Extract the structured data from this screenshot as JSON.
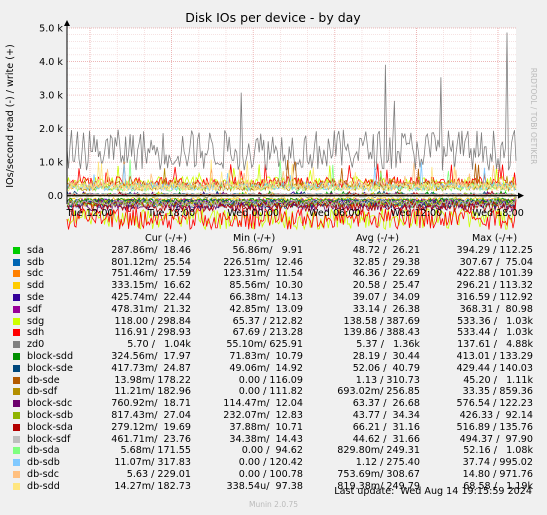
{
  "chart_data": {
    "type": "line",
    "title": "Disk IOs per device - by day",
    "ylabel": "IOs/second read (-) / write (+)",
    "side_label": "RRDTOOL / TOBI OETIKER",
    "ylim": [
      -0.25,
      5.0
    ],
    "y_ticks": [
      "5.0 k",
      "4.0 k",
      "3.0 k",
      "2.0 k",
      "1.0 k",
      "0.0"
    ],
    "y_tick_values": [
      5000,
      4000,
      3000,
      2000,
      1000,
      0
    ],
    "x_ticks": [
      "Tue 12:00",
      "Tue 18:00",
      "Wed 00:00",
      "Wed 06:00",
      "Wed 12:00",
      "Wed 18:00"
    ],
    "legend_headers": [
      "Cur (-/+)",
      "Min (-/+)",
      "Avg (-/+)",
      "Max (-/+)"
    ],
    "series": [
      {
        "name": "sda",
        "color": "#00cc00",
        "cur": "287.86m/  18.46",
        "min": "56.86m/   9.91",
        "avg": "48.72 /  26.21",
        "max": "394.29 / 112.25"
      },
      {
        "name": "sdb",
        "color": "#0066b3",
        "cur": "801.12m/  25.54",
        "min": "226.51m/  12.46",
        "avg": "32.85 /  29.38",
        "max": "307.67 /  75.04"
      },
      {
        "name": "sdc",
        "color": "#ff8000",
        "cur": "751.46m/  17.59",
        "min": "123.31m/  11.54",
        "avg": "46.36 /  22.69",
        "max": "422.88 / 101.39"
      },
      {
        "name": "sdd",
        "color": "#ffcc00",
        "cur": "333.15m/  16.62",
        "min": "85.56m/  10.30",
        "avg": "20.58 /  25.47",
        "max": "296.21 / 113.32"
      },
      {
        "name": "sde",
        "color": "#330099",
        "cur": "425.74m/  22.44",
        "min": "66.38m/  14.13",
        "avg": "39.07 /  34.09",
        "max": "316.59 / 112.92"
      },
      {
        "name": "sdf",
        "color": "#990099",
        "cur": "478.31m/  21.32",
        "min": "42.85m/  13.09",
        "avg": "33.14 /  26.38",
        "max": "368.31 /  80.98"
      },
      {
        "name": "sdg",
        "color": "#ccff00",
        "cur": "118.00 / 298.84",
        "min": "65.37 / 212.82",
        "avg": "138.58 / 387.69",
        "max": "533.36 /   1.03k"
      },
      {
        "name": "sdh",
        "color": "#ff0000",
        "cur": "116.91 / 298.93",
        "min": "67.69 / 213.28",
        "avg": "139.86 / 388.43",
        "max": "533.44 /   1.03k"
      },
      {
        "name": "zd0",
        "color": "#808080",
        "cur": "5.70 /   1.04k",
        "min": "55.10m/ 625.91",
        "avg": "5.37 /   1.36k",
        "max": "137.61 /   4.88k"
      },
      {
        "name": "block-sdd",
        "color": "#008f00",
        "cur": "324.56m/  17.97",
        "min": "71.83m/  10.79",
        "avg": "28.19 /  30.44",
        "max": "413.01 / 133.29"
      },
      {
        "name": "block-sde",
        "color": "#00487d",
        "cur": "417.73m/  24.87",
        "min": "49.06m/  14.92",
        "avg": "52.06 /  40.79",
        "max": "429.44 / 140.03"
      },
      {
        "name": "db-sde",
        "color": "#b35a00",
        "cur": "13.98m/ 178.22",
        "min": "0.00 / 116.09",
        "avg": "1.13 / 310.73",
        "max": "45.20 /   1.11k"
      },
      {
        "name": "db-sdf",
        "color": "#b38f00",
        "cur": "11.21m/ 182.96",
        "min": "0.00 / 111.82",
        "avg": "693.02m/ 256.85",
        "max": "33.35 / 859.36"
      },
      {
        "name": "block-sdc",
        "color": "#6b006b",
        "cur": "760.92m/  18.71",
        "min": "114.47m/  12.04",
        "avg": "63.37 /  26.68",
        "max": "576.54 / 122.23"
      },
      {
        "name": "block-sdb",
        "color": "#8fb300",
        "cur": "817.43m/  27.04",
        "min": "232.07m/  12.83",
        "avg": "43.77 /  34.34",
        "max": "426.33 /  92.14"
      },
      {
        "name": "block-sda",
        "color": "#b30000",
        "cur": "279.12m/  19.69",
        "min": "37.88m/  10.71",
        "avg": "66.21 /  31.16",
        "max": "516.89 / 135.76"
      },
      {
        "name": "block-sdf",
        "color": "#bebebe",
        "cur": "461.71m/  23.76",
        "min": "34.38m/  14.43",
        "avg": "44.62 /  31.66",
        "max": "494.37 /  97.90"
      },
      {
        "name": "db-sda",
        "color": "#80ff80",
        "cur": "5.68m/ 171.55",
        "min": "0.00 /  94.62",
        "avg": "829.80m/ 249.31",
        "max": "52.16 /   1.08k"
      },
      {
        "name": "db-sdb",
        "color": "#80c9ff",
        "cur": "11.07m/ 317.83",
        "min": "0.00 / 120.42",
        "avg": "1.12 / 275.40",
        "max": "37.74 / 995.02"
      },
      {
        "name": "db-sdc",
        "color": "#ffc080",
        "cur": "5.63 / 229.01",
        "min": "0.00 / 100.78",
        "avg": "753.69m/ 308.67",
        "max": "14.80 / 971.76"
      },
      {
        "name": "db-sdd",
        "color": "#ffe680",
        "cur": "14.27m/ 182.73",
        "min": "338.54u/  97.38",
        "avg": "819.38m/ 249.79",
        "max": "68.58 /   1.19k"
      }
    ]
  },
  "footer": {
    "last_update": "Last update:  Wed Aug 14 19:15:59 2024",
    "version": "Munin 2.0.75"
  }
}
